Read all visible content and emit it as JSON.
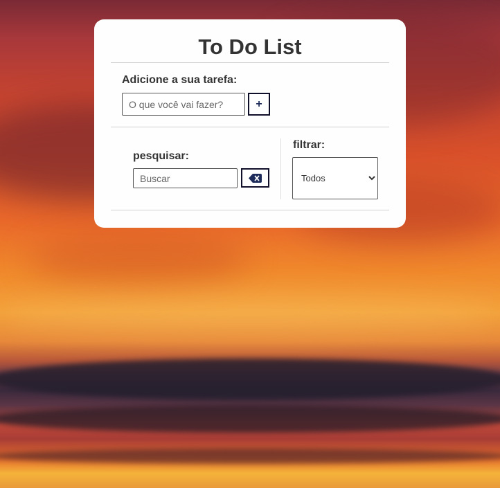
{
  "app": {
    "title": "To Do List"
  },
  "add_section": {
    "label": "Adicione a sua tarefa:",
    "input_placeholder": "O que você vai fazer?",
    "input_value": "",
    "add_button_label": "+"
  },
  "search_section": {
    "label": "pesquisar:",
    "input_placeholder": "Buscar",
    "input_value": "",
    "clear_icon": "backspace-icon"
  },
  "filter_section": {
    "label": "filtrar:",
    "selected": "Todos",
    "options": [
      "Todos"
    ]
  },
  "colors": {
    "card_background": "#fefefe",
    "text": "#333333",
    "button_border": "#0f0f2a",
    "button_icon": "#1c2b5a"
  }
}
